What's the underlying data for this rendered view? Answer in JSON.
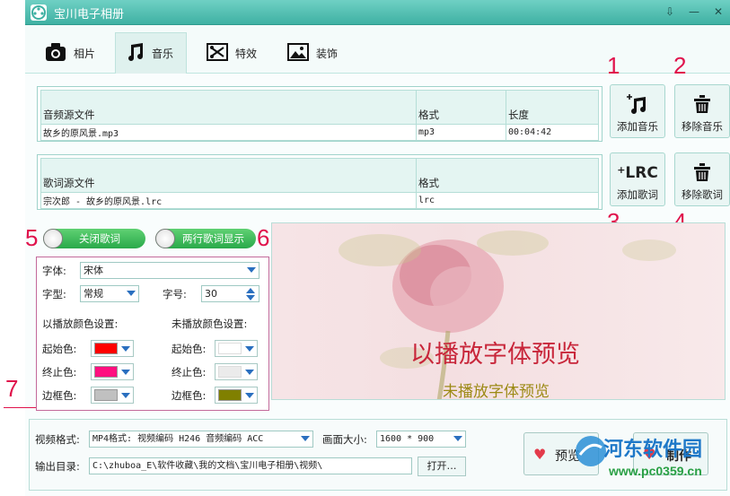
{
  "window": {
    "title": "宝川电子相册"
  },
  "tabs": [
    {
      "label": "相片",
      "icon": "camera-icon"
    },
    {
      "label": "音乐",
      "icon": "music-icon"
    },
    {
      "label": "特效",
      "icon": "effects-icon"
    },
    {
      "label": "装饰",
      "icon": "picture-icon"
    }
  ],
  "audio": {
    "headers": [
      "音频源文件",
      "格式",
      "长度"
    ],
    "rows": [
      [
        "故乡的原风景.mp3",
        "mp3",
        "00:04:42"
      ]
    ]
  },
  "lyrics": {
    "headers": [
      "歌词源文件",
      "格式"
    ],
    "rows": [
      [
        "宗次郎 - 故乡的原风景.lrc",
        "lrc"
      ]
    ]
  },
  "buttons": {
    "add_music": "添加音乐",
    "remove_music": "移除音乐",
    "add_lyrics": "添加歌词",
    "remove_lyrics": "移除歌词",
    "add_lyrics_icon_text": "LRC"
  },
  "annotations": {
    "n1": "1",
    "n2": "2",
    "n3": "3",
    "n4": "4",
    "n5": "5",
    "n6": "6",
    "n7": "7"
  },
  "toggles": {
    "close_lyrics": "关闭歌词",
    "two_line": "两行歌词显示"
  },
  "settings": {
    "font_label": "字体:",
    "font_value": "宋体",
    "style_label": "字型:",
    "style_value": "常规",
    "size_label": "字号:",
    "size_value": "30",
    "played_header": "以播放颜色设置:",
    "unplayed_header": "未播放颜色设置:",
    "start_label": "起始色:",
    "end_label": "终止色:",
    "border_label": "边框色:",
    "played_colors": {
      "start": "#ff0000",
      "end": "#ff0f7f",
      "border": "#c0c0c0"
    },
    "unplayed_colors": {
      "start": "#ffffff",
      "end": "#ebebeb",
      "border": "#808000"
    }
  },
  "preview": {
    "played_text": "以播放字体预览",
    "unplayed_text": "未播放字体预览"
  },
  "output": {
    "format_label": "视频格式:",
    "format_value": "MP4格式: 视频编码 H246 音频编码 ACC",
    "size_label": "画面大小:",
    "size_value": "1600 * 900",
    "dir_label": "输出目录:",
    "dir_value": "C:\\zhuboa_E\\软件收藏\\我的文档\\宝川电子相册\\视频\\",
    "open_button": "打开…",
    "preview_button": "预览",
    "make_button": "制作"
  },
  "watermark": {
    "text1": "河东软件园",
    "text2": "www.pc0359.cn"
  },
  "colors": {
    "accent": "#3fb1a3",
    "annotation": "#e0134c",
    "toggle": "#2aa94a"
  }
}
